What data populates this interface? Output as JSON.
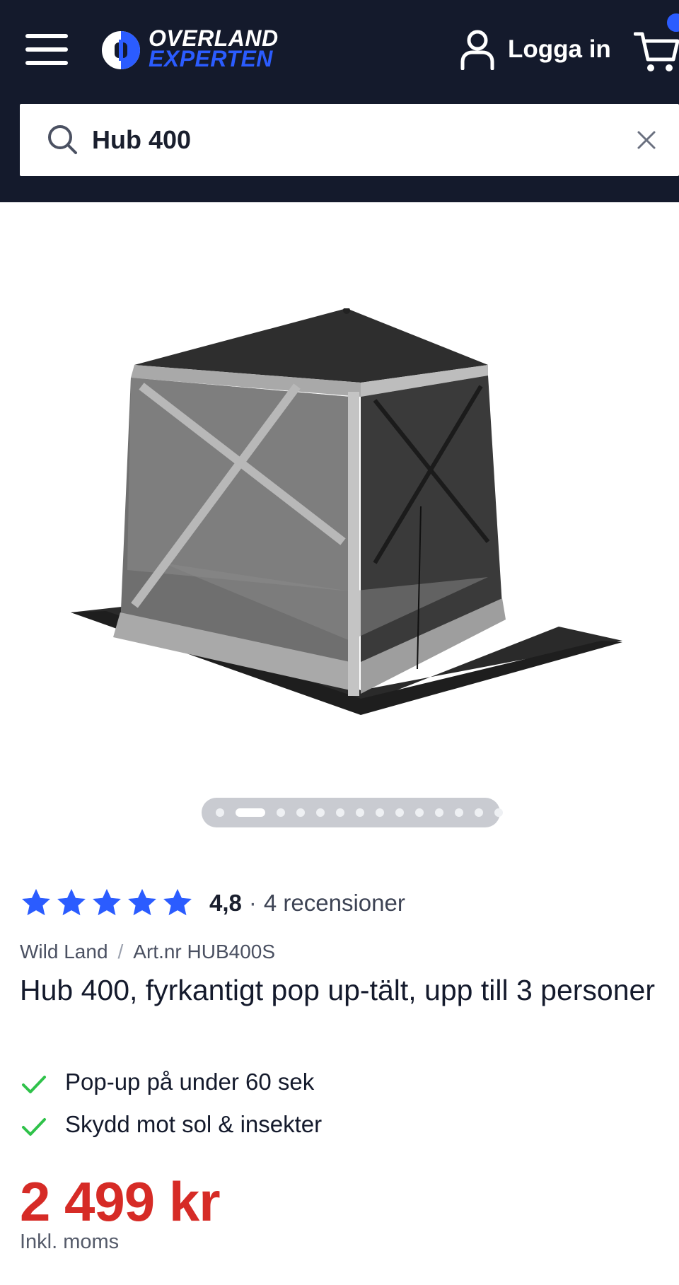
{
  "header": {
    "logo_line1": "OVERLAND",
    "logo_line2": "EXPERTEN",
    "login_label": "Logga in"
  },
  "search": {
    "value": "Hub 400"
  },
  "gallery": {
    "image_count": 14,
    "active_index": 1
  },
  "product": {
    "rating_value": 5,
    "rating_max": 5,
    "rating_text": "4,8",
    "rating_separator": "·",
    "reviews_text": "4 recensioner",
    "brand": "Wild Land",
    "meta_separator": "/",
    "article_number": "Art.nr HUB400S",
    "title": "Hub 400, fyrkantigt pop up-tält, upp till 3 personer",
    "features": [
      "Pop-up på under 60 sek",
      "Skydd mot sol & insekter"
    ],
    "price": "2 499 kr",
    "vat_note": "Inkl. moms"
  },
  "colors": {
    "header_bg": "#141a2c",
    "accent_blue": "#2b5cff",
    "star_blue": "#2b5cff",
    "check_green": "#2fc24a",
    "price_red": "#d62b26"
  },
  "icons": {
    "menu": "hamburger-menu-icon",
    "account": "user-icon",
    "cart": "shopping-cart-icon",
    "search": "magnifier-icon",
    "clear": "close-icon",
    "star": "star-icon",
    "check": "checkmark-icon"
  }
}
